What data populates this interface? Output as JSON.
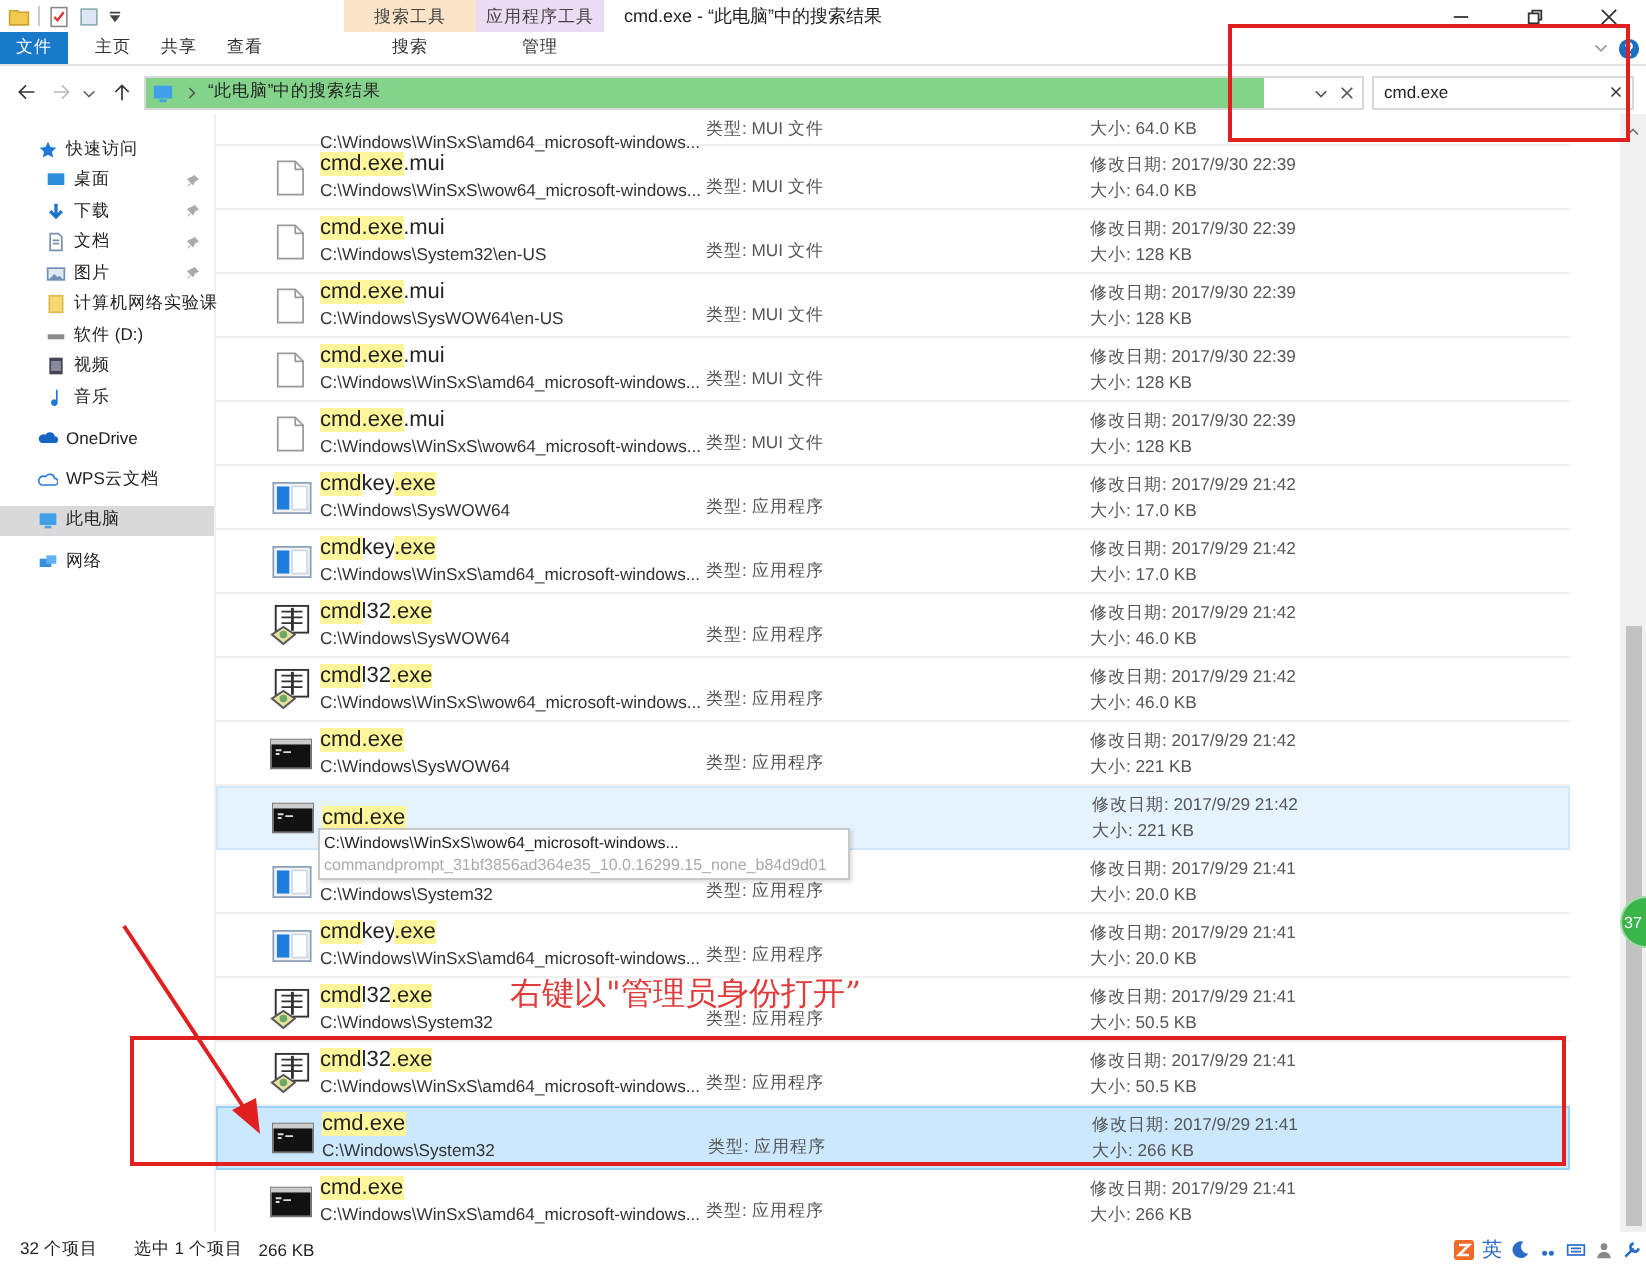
{
  "window": {
    "title": "cmd.exe - “此电脑”中的搜索结果"
  },
  "context_groups": [
    {
      "label": "搜索工具",
      "color": "#fbe3c8",
      "tabs": [
        {
          "label": "搜索"
        }
      ]
    },
    {
      "label": "应用程序工具",
      "color": "#ecdcf3",
      "tabs": [
        {
          "label": "管理"
        }
      ]
    }
  ],
  "ribbon_tabs": [
    {
      "label": "文件",
      "kind": "file"
    },
    {
      "label": "主页",
      "kind": "tab"
    },
    {
      "label": "共享",
      "kind": "tab"
    },
    {
      "label": "查看",
      "kind": "tab"
    }
  ],
  "address": {
    "path": "“此电脑”中的搜索结果",
    "level": 0.92
  },
  "search": {
    "value": "cmd.exe"
  },
  "sidebar": {
    "items": [
      {
        "label": "快速访问",
        "kind": "star",
        "selected": false,
        "children": [
          {
            "label": "桌面",
            "kind": "desktop",
            "pinned": true,
            "selected": false
          },
          {
            "label": "下载",
            "kind": "download",
            "pinned": true,
            "selected": false
          },
          {
            "label": "文档",
            "kind": "document",
            "pinned": true,
            "selected": false
          },
          {
            "label": "图片",
            "kind": "pictures",
            "pinned": true,
            "selected": false
          },
          {
            "label": "计算机网络实验课",
            "kind": "folder",
            "pinned": false,
            "selected": false
          },
          {
            "label": "软件 (D:)",
            "kind": "drive",
            "pinned": false,
            "selected": false
          },
          {
            "label": "视频",
            "kind": "video",
            "pinned": false,
            "selected": false
          },
          {
            "label": "音乐",
            "kind": "music",
            "pinned": false,
            "selected": false
          }
        ]
      },
      {
        "label": "OneDrive",
        "kind": "cloud",
        "selected": false
      },
      {
        "label": "WPS云文档",
        "kind": "cloud-outline",
        "selected": false
      },
      {
        "label": "此电脑",
        "kind": "pc",
        "selected": true
      },
      {
        "label": "网络",
        "kind": "network",
        "selected": false
      }
    ]
  },
  "rows": [
    {
      "path": "C:\\Windows\\WinSxS\\amd64_microsoft-windows...",
      "type": "类型: MUI 文件",
      "size": "大小: 64.0 KB",
      "hovered": false,
      "selected": false
    },
    {
      "kind": "mui",
      "name": [
        {
          "text": "cmd.exe",
          "highlight": true
        },
        {
          "text": ".mui",
          "highlight": false
        }
      ],
      "path": "C:\\Windows\\WinSxS\\wow64_microsoft-windows...",
      "type": "类型: MUI 文件",
      "modified": "修改日期: 2017/9/30 22:39",
      "size": "大小: 64.0 KB",
      "hovered": false,
      "selected": false
    },
    {
      "kind": "mui",
      "name": [
        {
          "text": "cmd.exe",
          "highlight": true
        },
        {
          "text": ".mui",
          "highlight": false
        }
      ],
      "path": "C:\\Windows\\System32\\en-US",
      "type": "类型: MUI 文件",
      "modified": "修改日期: 2017/9/30 22:39",
      "size": "大小: 128 KB",
      "hovered": false,
      "selected": false
    },
    {
      "kind": "mui",
      "name": [
        {
          "text": "cmd.exe",
          "highlight": true
        },
        {
          "text": ".mui",
          "highlight": false
        }
      ],
      "path": "C:\\Windows\\SysWOW64\\en-US",
      "type": "类型: MUI 文件",
      "modified": "修改日期: 2017/9/30 22:39",
      "size": "大小: 128 KB",
      "hovered": false,
      "selected": false
    },
    {
      "kind": "mui",
      "name": [
        {
          "text": "cmd.exe",
          "highlight": true
        },
        {
          "text": ".mui",
          "highlight": false
        }
      ],
      "path": "C:\\Windows\\WinSxS\\amd64_microsoft-windows...",
      "type": "类型: MUI 文件",
      "modified": "修改日期: 2017/9/30 22:39",
      "size": "大小: 128 KB",
      "hovered": false,
      "selected": false
    },
    {
      "kind": "mui",
      "name": [
        {
          "text": "cmd.exe",
          "highlight": true
        },
        {
          "text": ".mui",
          "highlight": false
        }
      ],
      "path": "C:\\Windows\\WinSxS\\wow64_microsoft-windows...",
      "type": "类型: MUI 文件",
      "modified": "修改日期: 2017/9/30 22:39",
      "size": "大小: 128 KB",
      "hovered": false,
      "selected": false
    },
    {
      "kind": "cmdkey",
      "name": [
        {
          "text": "cmd",
          "highlight": true
        },
        {
          "text": "key",
          "highlight": false
        },
        {
          "text": ".exe",
          "highlight": true
        }
      ],
      "path": "C:\\Windows\\SysWOW64",
      "type": "类型: 应用程序",
      "modified": "修改日期: 2017/9/29 21:42",
      "size": "大小: 17.0 KB",
      "hovered": false,
      "selected": false
    },
    {
      "kind": "cmdkey",
      "name": [
        {
          "text": "cmd",
          "highlight": true
        },
        {
          "text": "key",
          "highlight": false
        },
        {
          "text": ".exe",
          "highlight": true
        }
      ],
      "path": "C:\\Windows\\WinSxS\\amd64_microsoft-windows...",
      "type": "类型: 应用程序",
      "modified": "修改日期: 2017/9/29 21:42",
      "size": "大小: 17.0 KB",
      "hovered": false,
      "selected": false
    },
    {
      "kind": "cmdl32",
      "name": [
        {
          "text": "cmd",
          "highlight": true
        },
        {
          "text": "l32",
          "highlight": false
        },
        {
          "text": ".exe",
          "highlight": true
        }
      ],
      "path": "C:\\Windows\\SysWOW64",
      "type": "类型: 应用程序",
      "modified": "修改日期: 2017/9/29 21:42",
      "size": "大小: 46.0 KB",
      "hovered": false,
      "selected": false
    },
    {
      "kind": "cmdl32",
      "name": [
        {
          "text": "cmd",
          "highlight": true
        },
        {
          "text": "l32",
          "highlight": false
        },
        {
          "text": ".exe",
          "highlight": true
        }
      ],
      "path": "C:\\Windows\\WinSxS\\wow64_microsoft-windows...",
      "type": "类型: 应用程序",
      "modified": "修改日期: 2017/9/29 21:42",
      "size": "大小: 46.0 KB",
      "hovered": false,
      "selected": false
    },
    {
      "kind": "cmd",
      "name": [
        {
          "text": "cmd.exe",
          "highlight": true
        }
      ],
      "path": "C:\\Windows\\SysWOW64",
      "type": "类型: 应用程序",
      "modified": "修改日期: 2017/9/29 21:42",
      "size": "大小: 221 KB",
      "hovered": false,
      "selected": false
    },
    {
      "kind": "cmd",
      "name": [
        {
          "text": "cmd.exe",
          "highlight": true
        }
      ],
      "modified": "修改日期: 2017/9/29 21:42",
      "size": "大小: 221 KB",
      "hovered": true,
      "selected": false
    },
    {
      "kind": "cmdkey",
      "path": "C:\\Windows\\System32",
      "type": "类型: 应用程序",
      "modified": "修改日期: 2017/9/29 21:41",
      "size": "大小: 20.0 KB",
      "hovered": false,
      "selected": false
    },
    {
      "kind": "cmdkey",
      "name": [
        {
          "text": "cmd",
          "highlight": true
        },
        {
          "text": "key",
          "highlight": false
        },
        {
          "text": ".exe",
          "highlight": true
        }
      ],
      "path": "C:\\Windows\\WinSxS\\amd64_microsoft-windows...",
      "type": "类型: 应用程序",
      "modified": "修改日期: 2017/9/29 21:41",
      "size": "大小: 20.0 KB",
      "hovered": false,
      "selected": false
    },
    {
      "kind": "cmdl32",
      "name": [
        {
          "text": "cmd",
          "highlight": true
        },
        {
          "text": "l32",
          "highlight": false
        },
        {
          "text": ".exe",
          "highlight": true
        }
      ],
      "path": "C:\\Windows\\System32",
      "type": "类型: 应用程序",
      "modified": "修改日期: 2017/9/29 21:41",
      "size": "大小: 50.5 KB",
      "hovered": false,
      "selected": false
    },
    {
      "kind": "cmdl32",
      "name": [
        {
          "text": "cmd",
          "highlight": true
        },
        {
          "text": "l32",
          "highlight": false
        },
        {
          "text": ".exe",
          "highlight": true
        }
      ],
      "path": "C:\\Windows\\WinSxS\\amd64_microsoft-windows...",
      "type": "类型: 应用程序",
      "modified": "修改日期: 2017/9/29 21:41",
      "size": "大小: 50.5 KB",
      "hovered": false,
      "selected": false
    },
    {
      "kind": "cmd",
      "name": [
        {
          "text": "cmd.exe",
          "highlight": true
        }
      ],
      "path": "C:\\Windows\\System32",
      "type": "类型: 应用程序",
      "modified": "修改日期: 2017/9/29 21:41",
      "size": "大小: 266 KB",
      "hovered": false,
      "selected": true
    },
    {
      "kind": "cmd",
      "name": [
        {
          "text": "cmd.exe",
          "highlight": true
        }
      ],
      "path": "C:\\Windows\\WinSxS\\amd64_microsoft-windows...",
      "type": "类型: 应用程序",
      "modified": "修改日期: 2017/9/29 21:41",
      "size": "大小: 266 KB",
      "hovered": false,
      "selected": false
    }
  ],
  "tooltip": {
    "lines": [
      "C:\\Windows\\WinSxS\\wow64_microsoft-windows...",
      "commandprompt_31bf3856ad364e35_10.0.16299.15_none_b84d9d01"
    ]
  },
  "annotation": {
    "note": "右键以\"管理员身份打开”"
  },
  "badge": "37",
  "status_bar": {
    "count": "32 个项目",
    "selection": "选中 1 个项目",
    "size": "266 KB"
  },
  "ime": {
    "mode": "英"
  }
}
